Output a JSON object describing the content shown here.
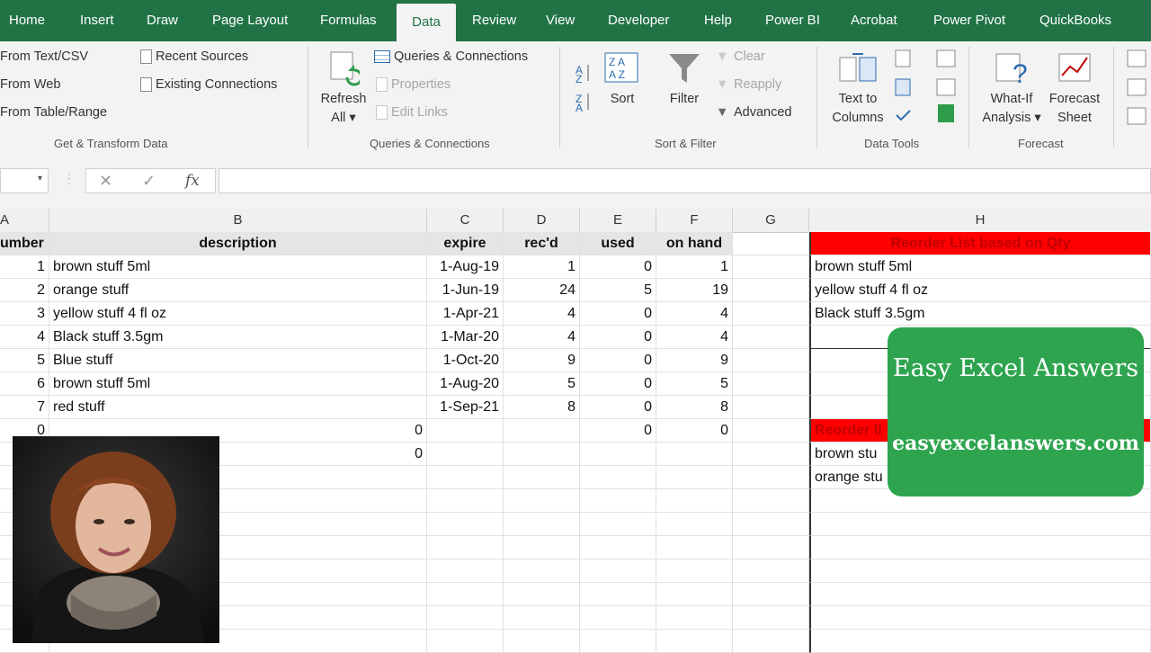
{
  "tabs": [
    "Home",
    "Insert",
    "Draw",
    "Page Layout",
    "Formulas",
    "Data",
    "Review",
    "View",
    "Developer",
    "Help",
    "Power BI",
    "Acrobat",
    "Power Pivot",
    "QuickBooks"
  ],
  "active_tab": "Data",
  "ribbon": {
    "get_transform": {
      "from_text_csv": "From Text/CSV",
      "from_web": "From Web",
      "from_table_range": "From Table/Range",
      "recent_sources": "Recent Sources",
      "existing_connections": "Existing Connections",
      "label": "Get & Transform Data"
    },
    "queries": {
      "refresh_all": "Refresh",
      "refresh_all_2": "All ▾",
      "queries_connections": "Queries & Connections",
      "properties": "Properties",
      "edit_links": "Edit Links",
      "label": "Queries & Connections"
    },
    "sort_filter": {
      "sort": "Sort",
      "filter": "Filter",
      "clear": "Clear",
      "reapply": "Reapply",
      "advanced": "Advanced",
      "label": "Sort & Filter"
    },
    "data_tools": {
      "text_to_columns": "Text to",
      "text_to_columns_2": "Columns",
      "label": "Data Tools"
    },
    "forecast": {
      "what_if": "What-If",
      "what_if_2": "Analysis ▾",
      "forecast_sheet": "Forecast",
      "forecast_sheet_2": "Sheet",
      "label": "Forecast"
    }
  },
  "formula_bar": {
    "fx": "fx",
    "cancel": "✕",
    "enter": "✓"
  },
  "columns": [
    "A",
    "B",
    "C",
    "D",
    "E",
    "F",
    "G",
    "H"
  ],
  "headers": {
    "a": "umber",
    "b": "description",
    "c": "expire",
    "d": "rec'd",
    "e": "used",
    "f": "on hand",
    "h": "Reorder List  based on Qty"
  },
  "rows": [
    {
      "a": "1",
      "b": "brown stuff             5ml",
      "c": "1-Aug-19",
      "d": "1",
      "e": "0",
      "f": "1"
    },
    {
      "a": "2",
      "b": "orange stuff",
      "c": "1-Jun-19",
      "d": "24",
      "e": "5",
      "f": "19"
    },
    {
      "a": "3",
      "b": "yellow stuff   4 fl oz",
      "c": "1-Apr-21",
      "d": "4",
      "e": "0",
      "f": "4"
    },
    {
      "a": "4",
      "b": "Black stuff       3.5gm",
      "c": "1-Mar-20",
      "d": "4",
      "e": "0",
      "f": "4"
    },
    {
      "a": "5",
      "b": "Blue stuff",
      "c": "1-Oct-20",
      "d": "9",
      "e": "0",
      "f": "9"
    },
    {
      "a": "6",
      "b": "brown stuff              5ml",
      "c": "1-Aug-20",
      "d": "5",
      "e": "0",
      "f": "5"
    },
    {
      "a": "7",
      "b": "red stuff",
      "c": "1-Sep-21",
      "d": "8",
      "e": "0",
      "f": "8"
    }
  ],
  "row8": {
    "a": "0",
    "b": "0",
    "e": "0",
    "f": "0"
  },
  "row9": {
    "b": "0"
  },
  "reorder_list": [
    "brown stuff             5ml",
    "yellow stuff   4 fl oz",
    "Black stuff       3.5gm"
  ],
  "reorder_list2": {
    "header": "Reorder li",
    "items": [
      "brown stu",
      "orange stu"
    ]
  },
  "badge": {
    "title": "Easy Excel Answers",
    "url": "easyexcelanswers.com"
  },
  "colors": {
    "excel_green": "#217346",
    "badge_green": "#2ea44f",
    "reorder_red": "#ff0000"
  }
}
